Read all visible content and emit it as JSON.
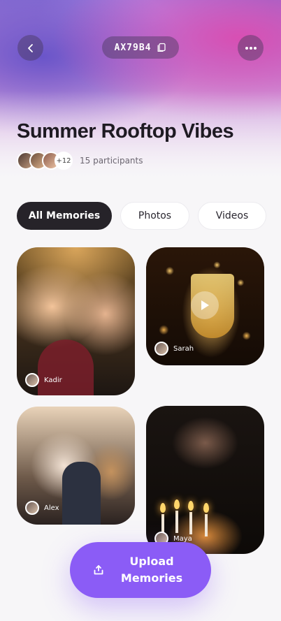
{
  "header": {
    "event_code": "AX79B4",
    "title": "Summer Rooftop Vibes",
    "participants_extra": "+12",
    "participants_text": "15 participants",
    "icons": {
      "back": "chevron-left-icon",
      "copy": "copy-icon",
      "more": "more-horizontal-icon"
    }
  },
  "filters": [
    {
      "label": "All Memories",
      "active": true
    },
    {
      "label": "Photos",
      "active": false
    },
    {
      "label": "Videos",
      "active": false
    }
  ],
  "memories": [
    {
      "uploader": "Kadir",
      "type": "photo"
    },
    {
      "uploader": "Sarah",
      "type": "video"
    },
    {
      "uploader": "Alex",
      "type": "photo"
    },
    {
      "uploader": "Maya",
      "type": "photo"
    }
  ],
  "upload": {
    "label": "Upload Memories",
    "icon": "upload-icon"
  },
  "colors": {
    "accent": "#8b5cf6",
    "active_chip": "#262329",
    "background": "#f7f6f8"
  }
}
